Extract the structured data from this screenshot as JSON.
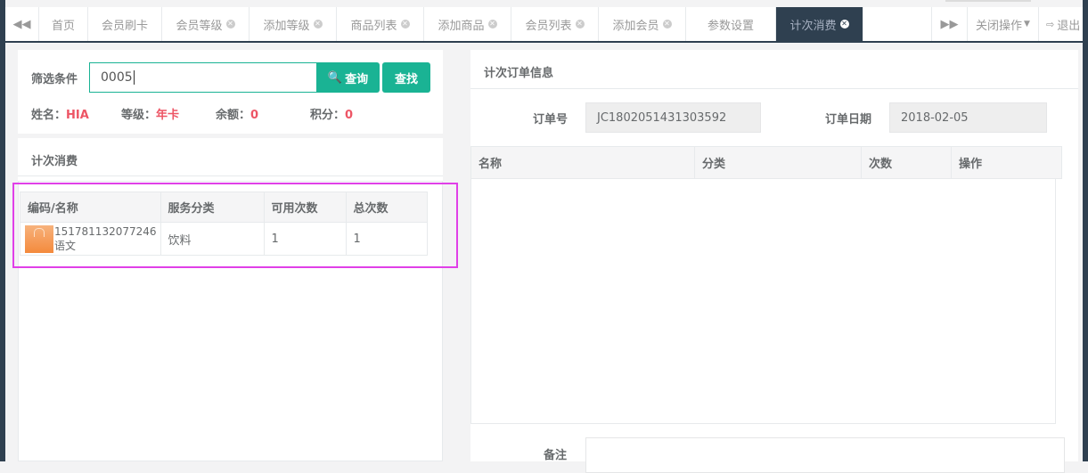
{
  "tabs": {
    "home": "首页",
    "items": [
      {
        "label": "会员刷卡",
        "closable": false
      },
      {
        "label": "会员等级",
        "closable": true
      },
      {
        "label": "添加等级",
        "closable": true
      },
      {
        "label": "商品列表",
        "closable": true
      },
      {
        "label": "添加商品",
        "closable": true
      },
      {
        "label": "会员列表",
        "closable": true
      },
      {
        "label": "添加会员",
        "closable": true
      },
      {
        "label": "参数设置",
        "closable": false
      },
      {
        "label": "计次消费",
        "closable": true,
        "active": true
      }
    ],
    "close_ops": "关闭操作",
    "logout": "退出"
  },
  "filter": {
    "label": "筛选条件",
    "value": "0005",
    "query_button": "查询",
    "find_button": "查找"
  },
  "member": {
    "name_label": "姓名：",
    "name": "HIA",
    "level_label": "等级：",
    "level": "年卡",
    "balance_label": "余额：",
    "balance": "0",
    "points_label": "积分：",
    "points": "0"
  },
  "consume": {
    "title": "计次消费",
    "headers": [
      "编码/名称",
      "服务分类",
      "可用次数",
      "总次数"
    ],
    "rows": [
      {
        "code": "151781132077246",
        "name": "语文",
        "category": "饮料",
        "available": "1",
        "total": "1"
      }
    ]
  },
  "order": {
    "title": "计次订单信息",
    "order_no_label": "订单号",
    "order_no": "JC1802051431303592",
    "order_date_label": "订单日期",
    "order_date": "2018-02-05",
    "headers": [
      "名称",
      "分类",
      "次数",
      "操作"
    ],
    "remark_label": "备注"
  }
}
